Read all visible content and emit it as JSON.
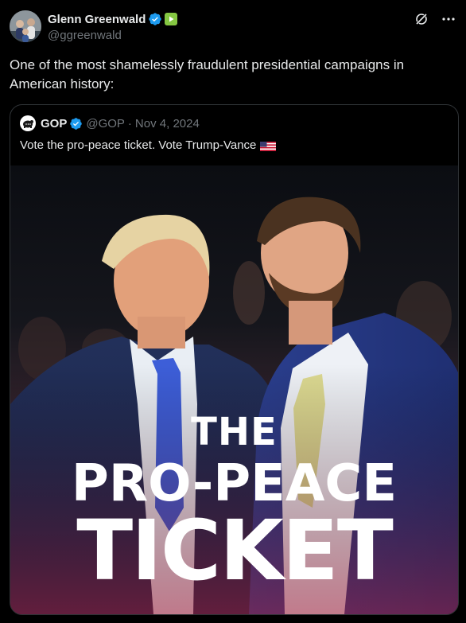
{
  "post": {
    "author_name": "Glenn Greenwald",
    "author_handle": "@ggreenwald",
    "text": "One of the most shamelessly fraudulent presidential campaigns in American history:"
  },
  "icons": {
    "verified": "verified-badge-icon",
    "rumble": "rumble-icon",
    "grok": "grok-icon",
    "more": "more-icon",
    "flag": "us-flag-icon"
  },
  "colors": {
    "background": "#000000",
    "text": "#e7e9ea",
    "secondary_text": "#71767b",
    "border": "#2f3336",
    "verified_blue": "#1d9bf0",
    "rumble_green": "#85c742"
  },
  "quoted": {
    "author_name": "GOP",
    "author_handle": "@GOP",
    "separator": "·",
    "date": "Nov 4, 2024",
    "text": "Vote the pro-peace ticket. Vote Trump-Vance",
    "image": {
      "headline_line1": "THE",
      "headline_line2": "PRO-PEACE",
      "headline_line3": "TICKET"
    }
  }
}
